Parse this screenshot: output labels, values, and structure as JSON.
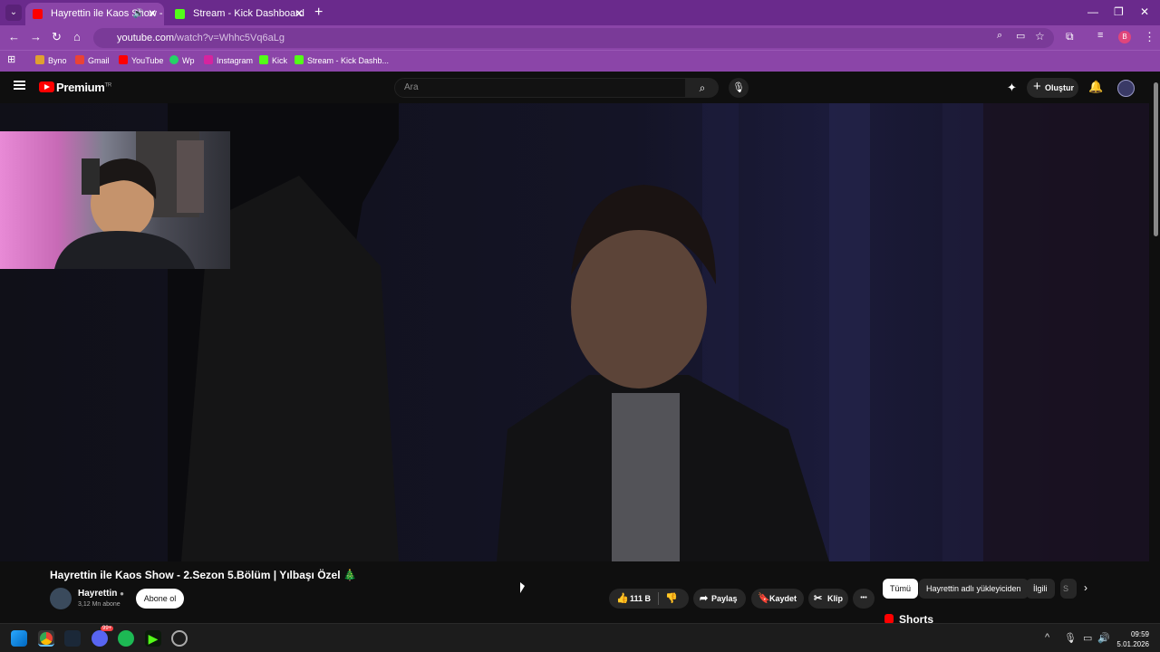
{
  "browser": {
    "tabs": [
      {
        "title": "Hayrettin ile Kaos Show - 2.",
        "active": true
      },
      {
        "title": "Stream - Kick Dashboard",
        "active": false
      }
    ],
    "url_host": "youtube.com",
    "url_path": "/watch?v=Whhc5Vq6aLg",
    "profile_initial": "B",
    "bookmarks": [
      "Byno",
      "Gmail",
      "YouTube",
      "Wp",
      "Instagram",
      "Kick",
      "Stream - Kick Dashb..."
    ]
  },
  "youtube": {
    "logo_text": "Premium",
    "logo_region": "TR",
    "search_placeholder": "Ara",
    "create_label": "Oluştur"
  },
  "video": {
    "title": "Hayrettin ile Kaos Show - 2.Sezon 5.Bölüm | Yılbaşı Özel 🎄",
    "channel": "Hayrettin",
    "subscribers": "3,12 Mn abone",
    "subscribe_label": "Abone ol",
    "likes": "111 B",
    "share_label": "Paylaş",
    "save_label": "Kaydet",
    "clip_label": "Klip",
    "more_label": "•••"
  },
  "chips": [
    "Tümü",
    "Hayrettin adlı yükleyiciden",
    "İlgili",
    "S"
  ],
  "shorts_heading": "Shorts",
  "taskbar": {
    "time": "09:59",
    "date": "5.01.2026",
    "discord_badge": "99+"
  },
  "colors": {
    "browser_frame": "#8b45a8",
    "youtube_red": "#ff0000",
    "kick_green": "#53fc18"
  }
}
